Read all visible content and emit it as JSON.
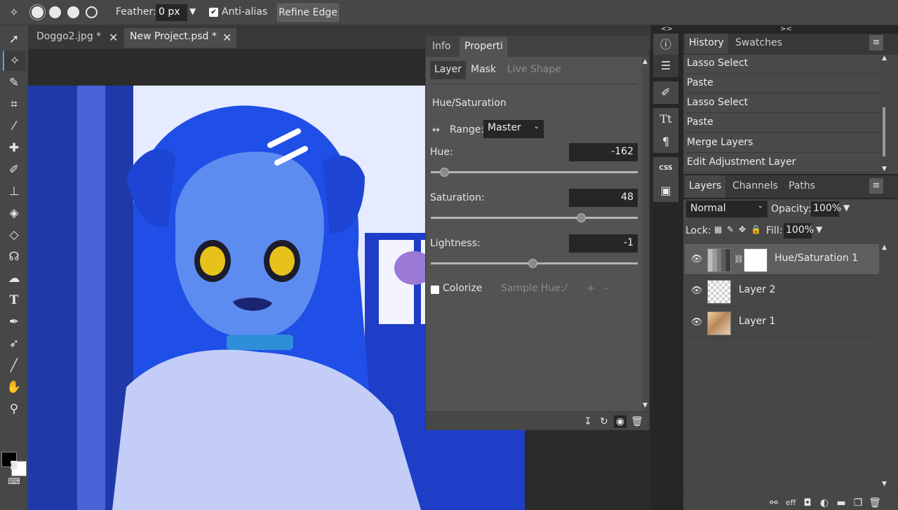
{
  "toolbar_options": {
    "feather_label": "Feather:",
    "feather_value": "0 px",
    "antialias_label": "Anti-alias",
    "antialias_checked": true,
    "refine_edge_label": "Refine Edge"
  },
  "document_tabs": [
    {
      "label": "Doggo2.jpg *",
      "active": false
    },
    {
      "label": "New Project.psd *",
      "active": true
    }
  ],
  "properties": {
    "tabs": [
      "Info",
      "Properti"
    ],
    "subtabs": [
      "Layer",
      "Mask",
      "Live Shape"
    ],
    "adjustment_title": "Hue/Saturation",
    "range_label": "Range:",
    "range_value": "Master",
    "hue_label": "Hue:",
    "hue_value": "-162",
    "saturation_label": "Saturation:",
    "saturation_value": "48",
    "lightness_label": "Lightness:",
    "lightness_value": "-1",
    "colorize_label": "Colorize",
    "sample_hue_label": "Sample Hue:",
    "plus": "+",
    "minus": "-"
  },
  "icon_strip": {
    "collapse_label": "<>",
    "css_label": "CSS"
  },
  "history": {
    "collapse_label": "><",
    "tabs": [
      "History",
      "Swatches"
    ],
    "items": [
      "Lasso Select",
      "Paste",
      "Lasso Select",
      "Paste",
      "Merge Layers",
      "Edit Adjustment Layer"
    ]
  },
  "layers": {
    "tabs": [
      "Layers",
      "Channels",
      "Paths"
    ],
    "blend_mode": "Normal",
    "opacity_label": "Opacity:",
    "opacity_value": "100%",
    "lock_label": "Lock:",
    "fill_label": "Fill:",
    "fill_value": "100%",
    "items": [
      {
        "name": "Hue/Saturation 1",
        "selected": true
      },
      {
        "name": "Layer 2",
        "selected": false
      },
      {
        "name": "Layer 1",
        "selected": false
      }
    ],
    "footer_eff": "eff"
  },
  "colors": {
    "accent": "#4aa3f5",
    "foreground": "#000000",
    "background": "#ffffff"
  }
}
